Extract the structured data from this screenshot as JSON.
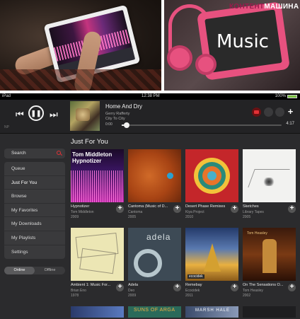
{
  "photos": {
    "right_brand_part1": "КОНТЕНТ",
    "right_brand_part2": "МАШИНА",
    "right_title": "Music"
  },
  "statusbar": {
    "device": "iPad",
    "time": "12:38 PM",
    "battery": "100%"
  },
  "player": {
    "tag": "NP",
    "title": "Home And Dry",
    "artist": "Gerry Rafferty",
    "album": "City To City",
    "elapsed": "0:00",
    "total": "4:17",
    "progress": 0.03
  },
  "section_title": "Just For You",
  "sidebar": {
    "search_label": "Search",
    "items": [
      {
        "label": "Queue"
      },
      {
        "label": "Just For You"
      },
      {
        "label": "Browse"
      },
      {
        "label": "My Favorites"
      },
      {
        "label": "My Downloads"
      },
      {
        "label": "My Playlists"
      },
      {
        "label": "Settings"
      }
    ],
    "active_index": 1,
    "toggle": {
      "on": "Online",
      "off": "Offline"
    }
  },
  "albums": [
    {
      "title": "Hypnotizer",
      "artist": "Tom Middleton",
      "year": "2009",
      "art_text": "Tom Middleton Hypnotizer"
    },
    {
      "title": "Cantoma (Music of D...",
      "artist": "Cantoma",
      "year": "2005"
    },
    {
      "title": "Desert Phase Remixes",
      "artist": "Kiya Project",
      "year": "2010"
    },
    {
      "title": "Sketches",
      "artist": "Library Tapes",
      "year": "2005"
    },
    {
      "title": "Ambient 1: Music For...",
      "artist": "Brian Eno",
      "year": "1978"
    },
    {
      "title": "Adela",
      "artist": "Deo",
      "year": "2009",
      "art_text": "adela"
    },
    {
      "title": "Remebay",
      "artist": "Ecocidek",
      "year": "2011",
      "art_text": "ecocidek"
    },
    {
      "title": "On The Sensations O...",
      "artist": "Tom Heasley",
      "year": "2002",
      "art_text": "Tom Heasley"
    }
  ],
  "row3": [
    {
      "art_text": ""
    },
    {
      "art_text": "SUNS OF ARGA"
    },
    {
      "art_text": "MARSH HALE"
    },
    {
      "art_text": ""
    }
  ],
  "colors": {
    "accent_red": "#e23136",
    "app_bg": "#2b2b2d",
    "panel": "#3a3a3c"
  }
}
